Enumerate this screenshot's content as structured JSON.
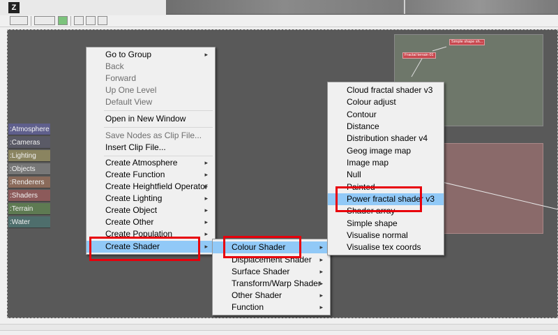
{
  "colors": {
    "canvas": "#595959",
    "highlight": "#91c9f7",
    "redbox": "#e8000b",
    "node": "#c8474e"
  },
  "side_tabs": [
    {
      "label": ":Atmosphere",
      "color": "#5f5f8c"
    },
    {
      "label": ":Cameras",
      "color": "#5a5a66"
    },
    {
      "label": ":Lighting",
      "color": "#8a8460"
    },
    {
      "label": ":Objects",
      "color": "#777777"
    },
    {
      "label": ":Renderers",
      "color": "#8a6a5a"
    },
    {
      "label": ":Shaders",
      "color": "#8c5a5a"
    },
    {
      "label": ":Terrain",
      "color": "#5e7a52"
    },
    {
      "label": ":Water",
      "color": "#4e6e6c"
    }
  ],
  "nodes": {
    "fractal_terrain": "Fractal terrain 01",
    "simple_shape": "Simple shape sh..."
  },
  "context_menu": {
    "go_to_group": "Go to Group",
    "back": "Back",
    "forward": "Forward",
    "up_one_level": "Up One Level",
    "default_view": "Default View",
    "open_new_window": "Open in New Window",
    "save_clip": "Save Nodes as Clip File...",
    "insert_clip": "Insert Clip File...",
    "create_atmosphere": "Create Atmosphere",
    "create_function": "Create Function",
    "create_heightfield_operator": "Create Heightfield Operator",
    "create_lighting": "Create Lighting",
    "create_object": "Create Object",
    "create_other": "Create Other",
    "create_population": "Create Population",
    "create_shader": "Create Shader"
  },
  "shader_submenu": {
    "colour_shader": "Colour Shader",
    "displacement_shader": "Displacement Shader",
    "surface_shader": "Surface Shader",
    "transform_warp_shader": "Transform/Warp Shader",
    "other_shader": "Other Shader",
    "function": "Function"
  },
  "colour_submenu": {
    "cloud_fractal": "Cloud fractal shader v3",
    "colour_adjust": "Colour adjust",
    "contour": "Contour",
    "distance": "Distance",
    "distribution": "Distribution shader v4",
    "geog_image_map": "Geog image map",
    "image_map": "Image map",
    "null": "Null",
    "painted": "Painted",
    "power_fractal": "Power fractal shader v3",
    "shader_array": "Shader array",
    "simple_shape": "Simple shape",
    "visualise_normal": "Visualise normal",
    "visualise_tex_coords": "Visualise tex coords"
  },
  "icons": {
    "arrow": "submenu-arrow-icon"
  }
}
